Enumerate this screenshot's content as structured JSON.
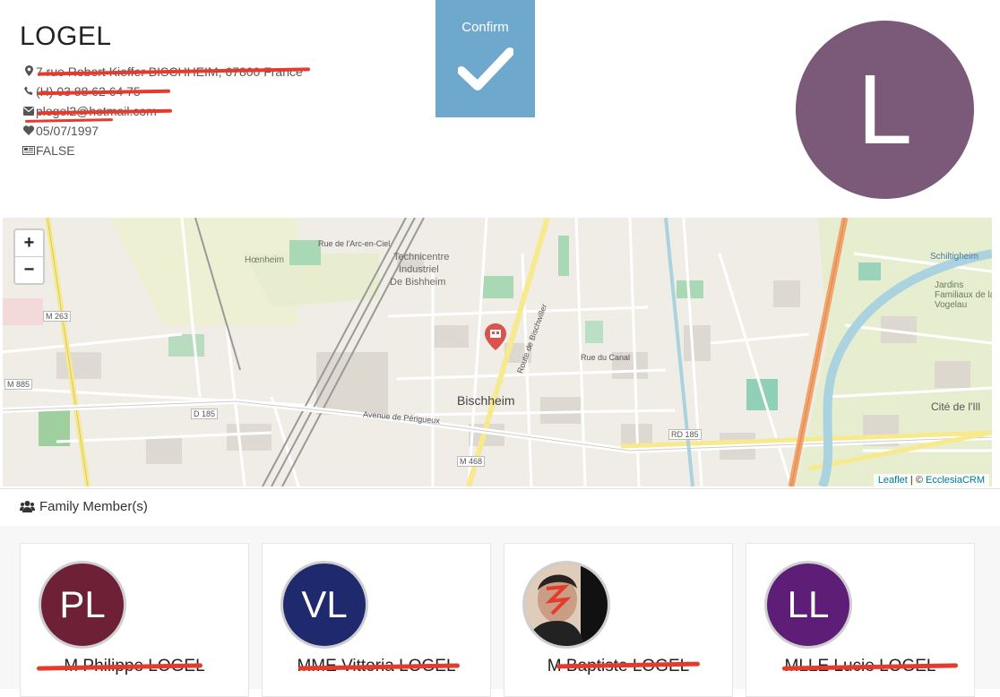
{
  "family": {
    "name": "LOGEL",
    "address": "7 rue Robert Kieffer BISCHHEIM, 67800 France",
    "phone": "(H) 03 88 62 64 75",
    "email": "plogel2@hotmail.com",
    "wedding_date": "05/07/1997",
    "flag": "FALSE",
    "initial": "L",
    "avatar_color": "#7a5979"
  },
  "confirm": {
    "label": "Confirm"
  },
  "map": {
    "zoom_in": "+",
    "zoom_out": "−",
    "attribution_leaflet": "Leaflet",
    "attribution_sep": " | © ",
    "attribution_owner": "EcclesiaCRM",
    "labels": {
      "hoenheim": "Hœnheim",
      "techni": "Technicentre",
      "indus": "Industriel",
      "debish": "De Bishheim",
      "bischheim": "Bischheim",
      "cite": "Cité de l'Ill",
      "schilt": "Schiltigheim",
      "jardins": "Jardins Familiaux de la Vogelau",
      "m263": "M 263",
      "m885": "M 885",
      "d185": "D 185",
      "m468": "M 468",
      "rd185": "RD 185",
      "rue_canal": "Rue du Canal",
      "ave_perigueux": "Avenue de Périgueux",
      "route_bischwiller": "Route de Bischwiller",
      "rue_arc": "Rue de l'Arc-en-Ciel"
    }
  },
  "section": {
    "title": "Family Member(s)"
  },
  "members": [
    {
      "initials": "PL",
      "name": "M Philippe LOGEL",
      "color": "#6e2136"
    },
    {
      "initials": "VL",
      "name": "MME Vittoria LOGEL",
      "color": "#1f2a6e"
    },
    {
      "initials": "",
      "name": "M Baptiste LOGEL",
      "color": "#caa892"
    },
    {
      "initials": "LL",
      "name": "MLLE Lucie LOGEL",
      "color": "#5e1e78"
    }
  ]
}
